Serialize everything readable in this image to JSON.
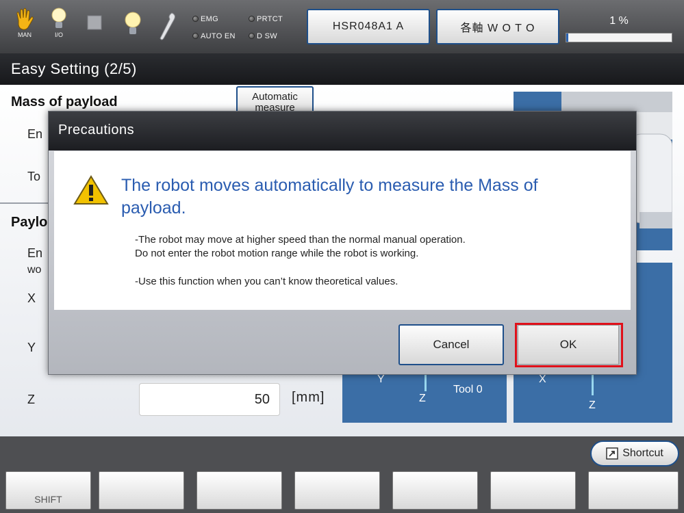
{
  "status_bar": {
    "icons": [
      {
        "name": "hand-icon",
        "caption": "MAN"
      },
      {
        "name": "lightbulb-io-icon",
        "caption": "I/O"
      },
      {
        "name": "stop-square-icon",
        "caption": ""
      },
      {
        "name": "lightbulb-icon",
        "caption": ""
      },
      {
        "name": "wrench-icon",
        "caption": ""
      }
    ],
    "lamps": {
      "emg": "EMG",
      "prtct": "PRTCT",
      "auto_en": "AUTO EN",
      "dsw": "D SW"
    },
    "robot_model": "HSR048A1 A",
    "axis_mode": "各軸 W O T O",
    "speed": {
      "label": "1 %",
      "value_fraction": 0.01
    },
    "colors": {
      "speed_fill": "#2a62b0"
    }
  },
  "screen": {
    "title": "Easy Setting (2/5)"
  },
  "background": {
    "mass_section_title": "Mass of payload",
    "automatic_button": "Automatic measure",
    "mass_row1_label": "En",
    "mass_row2_label": "To",
    "payload_section_title": "Paylo",
    "payload_row1_label": "En",
    "payload_row2_label": "wo",
    "x_label": "X",
    "y_label": "Y",
    "z_label": "Z",
    "z_value": "50",
    "z_unit": "[mm]",
    "tool_axis_labels": {
      "y": "Y",
      "z1": "Z",
      "x": "X",
      "z2": "Z"
    },
    "tool_label": "Tool 0"
  },
  "dialog": {
    "title": "Precautions",
    "headline": "The robot moves automatically to measure the Mass of payload.",
    "notes": {
      "line1": "-The robot may move at higher speed than the normal manual operation.",
      "line2": "Do not enter the robot motion range while the robot is working.",
      "line3": "-Use this function when you can’t know theoretical values."
    },
    "cancel_label": "Cancel",
    "ok_label": "OK",
    "colors": {
      "headline": "#2a5cb0",
      "highlight": "#e0101a",
      "warning": "#f2c200"
    }
  },
  "bottom": {
    "shortcut_label": "Shortcut",
    "function_keys": [
      "SHIFT",
      "",
      "",
      "",
      "",
      "",
      ""
    ]
  }
}
